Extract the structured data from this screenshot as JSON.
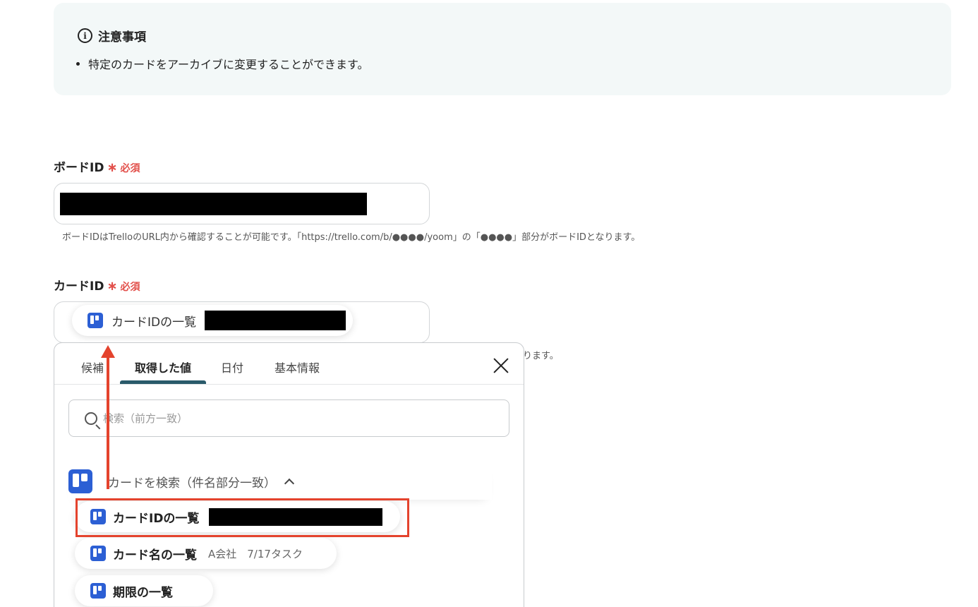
{
  "notice": {
    "title": "注意事項",
    "item": "特定のカードをアーカイブに変更することができます。"
  },
  "board_field": {
    "label": "ボードID",
    "required": "必須",
    "hint": "ボードIDはTrelloのURL内から確認することが可能です。「https://trello.com/b/●●●●/yoom」の「●●●●」部分がボードIDとなります。"
  },
  "card_field": {
    "label": "カードID",
    "required": "必須",
    "chip_label": "カードIDの一覧",
    "hint_tail": "ります。"
  },
  "popup": {
    "tabs": [
      "候補",
      "取得した値",
      "日付",
      "基本情報"
    ],
    "active_tab": "取得した値",
    "search_placeholder": "検索（前方一致）",
    "group": {
      "label": "カードを検索（件名部分一致）",
      "items": [
        {
          "label": "カードIDの一覧",
          "value": ""
        },
        {
          "label": "カード名の一覧",
          "value": "A会社　7/17タスク"
        },
        {
          "label": "期限の一覧",
          "value": ""
        }
      ]
    }
  },
  "colors": {
    "accent_red": "#e4432d",
    "required_red": "#e24f4a",
    "trello_blue": "#2c5fd4",
    "tab_underline": "#2a5a6a",
    "notice_bg": "#f3f8f8"
  }
}
